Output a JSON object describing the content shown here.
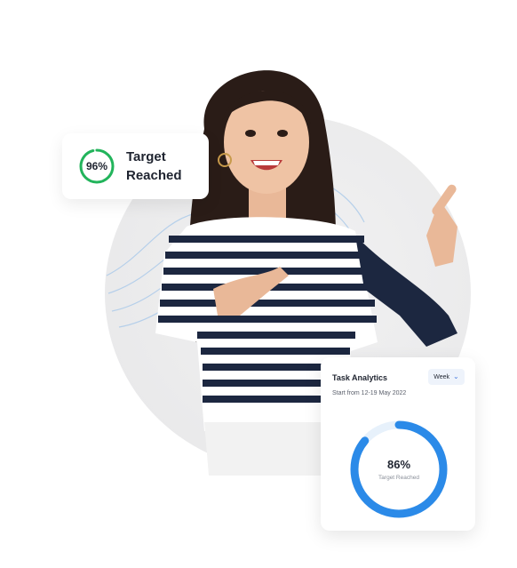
{
  "target_card": {
    "percent_text": "96%",
    "progress_fraction": 0.96,
    "label_line1": "Target",
    "label_line2": "Reached",
    "ring_color": "#22b45b"
  },
  "analytics_card": {
    "title": "Task Analytics",
    "period_select": "Week",
    "subtitle": "Start from 12-19 May 2022",
    "donut_percent_text": "86%",
    "donut_label": "Target Reached",
    "progress_fraction": 0.86,
    "donut_color": "#2b8ae8",
    "track_color": "#e7f1fb"
  },
  "icons": {
    "dropdown": "chevron-down-icon"
  }
}
